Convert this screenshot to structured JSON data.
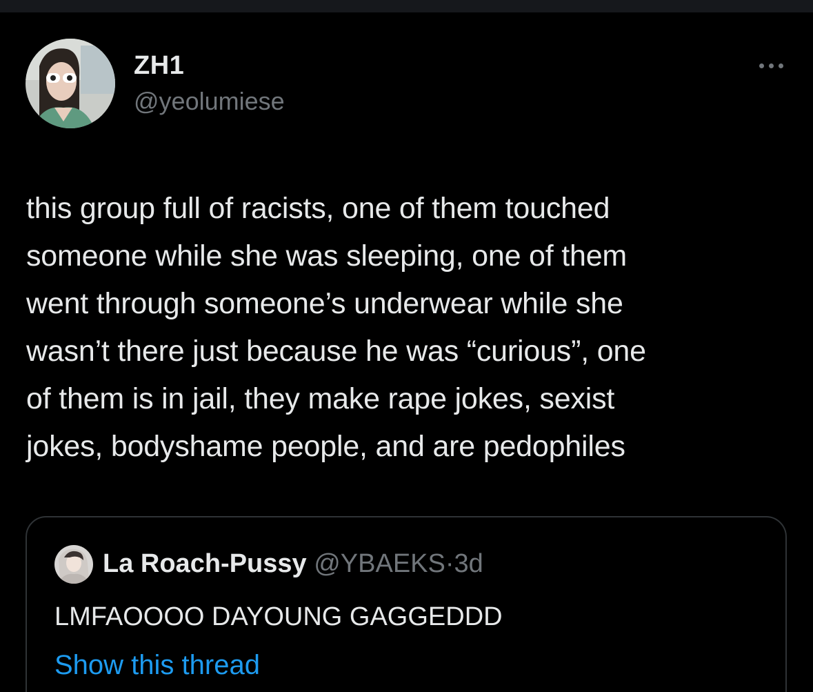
{
  "author": {
    "display_name": "ZH1",
    "handle": "@yeolumiese",
    "avatar_icon": "profile-photo"
  },
  "menu": {
    "icon": "more-horizontal-icon",
    "color": "#71767b"
  },
  "tweet": {
    "text": "this group full of racists, one of them touched\nsomeone while she was sleeping, one of them\nwent through someone’s underwear while she\nwasn’t there just because he was “curious”, one\nof them is in jail, they make rape jokes, sexist\njokes, bodyshame people, and are pedophiles"
  },
  "quote": {
    "display_name": "La Roach-Pussy",
    "handle": "@YBAEKS",
    "separator": "·",
    "time": "3d",
    "text": "LMFAOOOO DAYOUNG GAGGEDDD",
    "link_text": "Show this thread",
    "avatar_icon": "profile-photo"
  },
  "colors": {
    "background": "#000000",
    "text_primary": "#e7e9ea",
    "text_secondary": "#71767b",
    "link": "#1d9bf0",
    "border": "#2f3336"
  }
}
